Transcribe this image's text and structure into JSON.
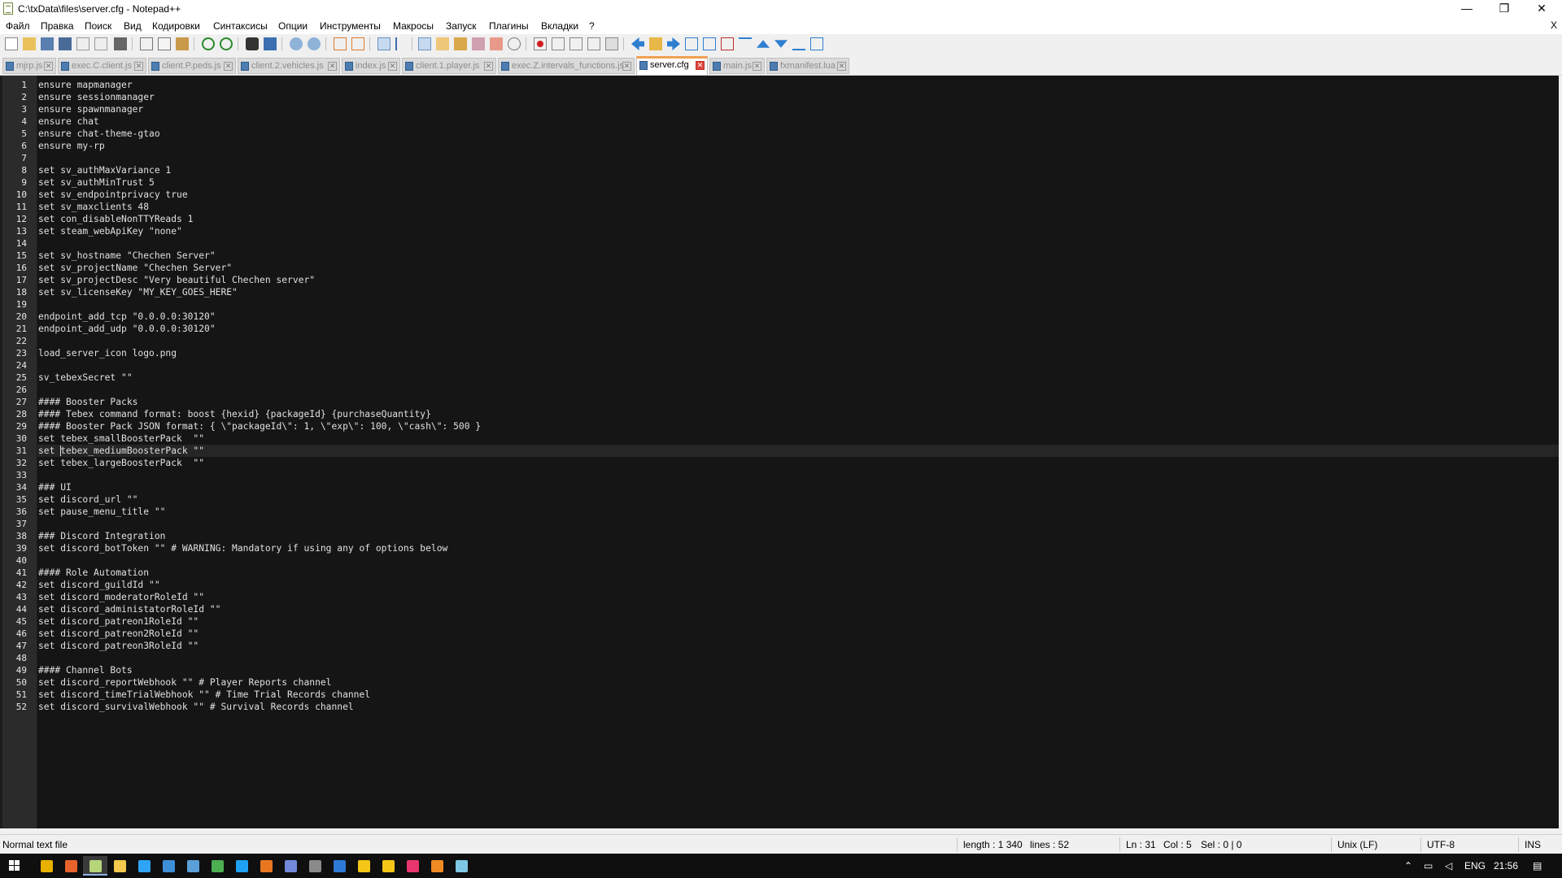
{
  "window": {
    "title": "C:\\txData\\files\\server.cfg - Notepad++",
    "minimize_glyph": "—",
    "maximize_glyph": "❐",
    "close_glyph": "✕"
  },
  "menu": {
    "items": [
      "Файл",
      "Правка",
      "Поиск",
      "Вид",
      "Кодировки",
      "Синтаксисы",
      "Опции",
      "Инструменты",
      "Макросы",
      "Запуск",
      "Плагины",
      "Вкладки",
      "?"
    ],
    "close_doc_glyph": "X"
  },
  "tabs": [
    {
      "label": "mjrp.js",
      "active": false
    },
    {
      "label": "exec.C.client.js",
      "active": false
    },
    {
      "label": "client.P.peds.js",
      "active": false
    },
    {
      "label": "client.2.vehicles.js",
      "active": false
    },
    {
      "label": "index.js",
      "active": false
    },
    {
      "label": "client.1.player.js",
      "active": false
    },
    {
      "label": "exec.Z.intervals_functions.js",
      "active": false
    },
    {
      "label": "server.cfg",
      "active": true
    },
    {
      "label": "main.js",
      "active": false
    },
    {
      "label": "fxmanifest.lua",
      "active": false
    }
  ],
  "editor": {
    "current_line": 31,
    "lines": [
      "ensure mapmanager",
      "ensure sessionmanager",
      "ensure spawnmanager",
      "ensure chat",
      "ensure chat-theme-gtao",
      "ensure my-rp",
      "",
      "set sv_authMaxVariance 1",
      "set sv_authMinTrust 5",
      "set sv_endpointprivacy true",
      "set sv_maxclients 48",
      "set con_disableNonTTYReads 1",
      "set steam_webApiKey \"none\"",
      "",
      "set sv_hostname \"Chechen Server\"",
      "set sv_projectName \"Chechen Server\"",
      "set sv_projectDesc \"Very beautiful Chechen server\"",
      "set sv_licenseKey \"MY_KEY_GOES_HERE\"",
      "",
      "endpoint_add_tcp \"0.0.0.0:30120\"",
      "endpoint_add_udp \"0.0.0.0:30120\"",
      "",
      "load_server_icon logo.png",
      "",
      "sv_tebexSecret \"\"",
      "",
      "#### Booster Packs",
      "#### Tebex command format: boost {hexid} {packageId} {purchaseQuantity}",
      "#### Booster Pack JSON format: { \\\"packageId\\\": 1, \\\"exp\\\": 100, \\\"cash\\\": 500 }",
      "set tebex_smallBoosterPack  \"\"",
      "set tebex_mediumBoosterPack \"\"",
      "set tebex_largeBoosterPack  \"\"",
      "",
      "### UI",
      "set discord_url \"\"",
      "set pause_menu_title \"\"",
      "",
      "### Discord Integration",
      "set discord_botToken \"\" # WARNING: Mandatory if using any of options below",
      "",
      "#### Role Automation",
      "set discord_guildId \"\"",
      "set discord_moderatorRoleId \"\"",
      "set discord_administatorRoleId \"\"",
      "set discord_patreon1RoleId \"\"",
      "set discord_patreon2RoleId \"\"",
      "set discord_patreon3RoleId \"\"",
      "",
      "#### Channel Bots",
      "set discord_reportWebhook \"\" # Player Reports channel",
      "set discord_timeTrialWebhook \"\" # Time Trial Records channel",
      "set discord_survivalWebhook \"\" # Survival Records channel"
    ]
  },
  "status": {
    "file_type": "Normal text file",
    "length": "length : 1 340",
    "lines": "lines : 52",
    "ln": "Ln : 31",
    "col": "Col : 5",
    "sel": "Sel : 0 | 0",
    "eol": "Unix (LF)",
    "encoding": "UTF-8",
    "mode": "INS"
  },
  "taskbar": {
    "language": "ENG",
    "time": "21:56",
    "apps": [
      {
        "icon": "chrome-icon",
        "color": "#e8b100"
      },
      {
        "icon": "firefox-icon",
        "color": "#e8632b"
      },
      {
        "icon": "notepadpp-icon",
        "color": "#b6d47a"
      },
      {
        "icon": "file-explorer-icon",
        "color": "#f2c94c"
      },
      {
        "icon": "photoshop-icon",
        "color": "#2fa3f7"
      },
      {
        "icon": "store-icon",
        "color": "#3f8fd8"
      },
      {
        "icon": "network-tool-icon",
        "color": "#5aa0d8"
      },
      {
        "icon": "app-green-icon",
        "color": "#4caf50"
      },
      {
        "icon": "skype-icon",
        "color": "#1ea1f1"
      },
      {
        "icon": "app-orange-icon",
        "color": "#e87722"
      },
      {
        "icon": "discord-icon",
        "color": "#7289da"
      },
      {
        "icon": "steam-icon",
        "color": "#8a8a8a"
      },
      {
        "icon": "app-blue-icon",
        "color": "#2c7bd6"
      },
      {
        "icon": "rockstar-icon",
        "color": "#f5c518"
      },
      {
        "icon": "rockstar2-icon",
        "color": "#f5c518"
      },
      {
        "icon": "app-pink-icon",
        "color": "#e8356d"
      },
      {
        "icon": "app-amber-icon",
        "color": "#f08a24"
      },
      {
        "icon": "notepad-icon",
        "color": "#7ec8e3"
      }
    ]
  },
  "colors": {
    "editor_bg": "#151515",
    "gutter_bg": "#2b2b2b",
    "active_tab_accent": "#f0a050",
    "tab_close_active": "#e0453a"
  }
}
